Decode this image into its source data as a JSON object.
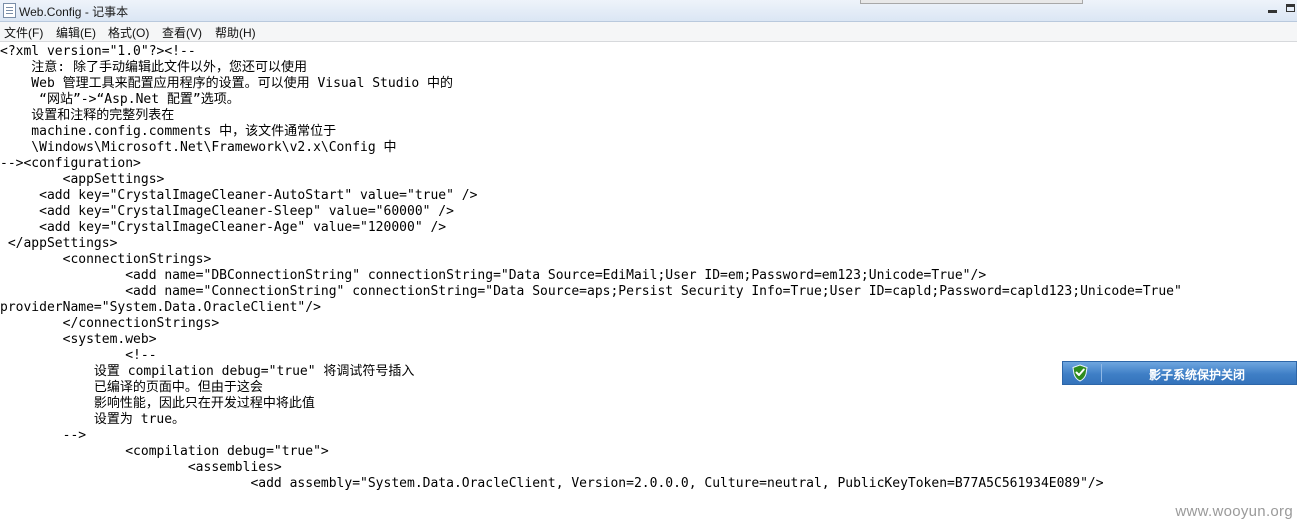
{
  "window": {
    "title": "Web.Config - 记事本"
  },
  "menu": {
    "items": [
      "文件(F)",
      "编辑(E)",
      "格式(O)",
      "查看(V)",
      "帮助(H)"
    ]
  },
  "editor": {
    "lines": [
      "<?xml version=\"1.0\"?><!--",
      "    注意: 除了手动编辑此文件以外，您还可以使用",
      "    Web 管理工具来配置应用程序的设置。可以使用 Visual Studio 中的",
      "     “网站”->“Asp.Net 配置”选项。",
      "    设置和注释的完整列表在",
      "    machine.config.comments 中，该文件通常位于",
      "    \\Windows\\Microsoft.Net\\Framework\\v2.x\\Config 中",
      "--><configuration>",
      "        <appSettings>",
      "     <add key=\"CrystalImageCleaner-AutoStart\" value=\"true\" />",
      "     <add key=\"CrystalImageCleaner-Sleep\" value=\"60000\" />",
      "     <add key=\"CrystalImageCleaner-Age\" value=\"120000\" />",
      " </appSettings>",
      "        <connectionStrings>",
      "                <add name=\"DBConnectionString\" connectionString=\"Data Source=EdiMail;User ID=em;Password=em123;Unicode=True\"/>",
      "                <add name=\"ConnectionString\" connectionString=\"Data Source=aps;Persist Security Info=True;User ID=capld;Password=capld123;Unicode=True\"",
      "providerName=\"System.Data.OracleClient\"/>",
      "        </connectionStrings>",
      "        <system.web>",
      "                <!--",
      "            设置 compilation debug=\"true\" 将调试符号插入",
      "            已编译的页面中。但由于这会",
      "            影响性能，因此只在开发过程中将此值",
      "            设置为 true。",
      "        -->",
      "                <compilation debug=\"true\">",
      "                        <assemblies>",
      "                                <add assembly=\"System.Data.OracleClient, Version=2.0.0.0, Culture=neutral, PublicKeyToken=B77A5C561934E089\"/>"
    ]
  },
  "notice": {
    "text": "影子系统保护关闭",
    "accent": "#3f7fc6",
    "icon": "shield-check-icon"
  },
  "watermark": {
    "text": "www.wooyun.org"
  }
}
